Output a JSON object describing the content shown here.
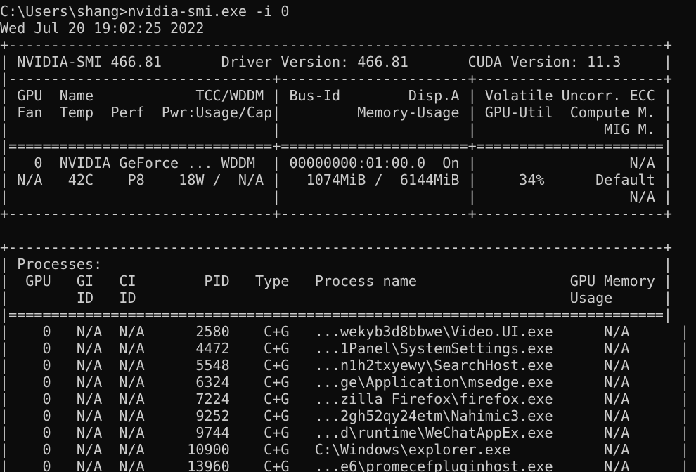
{
  "terminal": {
    "command_line": "C:\\Users\\shang>nvidia-smi.exe -i 0",
    "timestamp": "Wed Jul 20 19:02:25 2022",
    "colors": {
      "background": "#0c0c0c",
      "foreground": "#cccccc"
    }
  },
  "gpu_table": {
    "border_top": "+-----------------------------------------------------------------------------+",
    "header_info": "| NVIDIA-SMI 466.81       Driver Version: 466.81       CUDA Version: 11.3     |",
    "header_sep": "|-------------------------------+----------------------+----------------------+",
    "col_head_1": "| GPU  Name            TCC/WDDM | Bus-Id        Disp.A | Volatile Uncorr. ECC |",
    "col_head_2": "| Fan  Temp  Perf  Pwr:Usage/Cap|         Memory-Usage | GPU-Util  Compute M. |",
    "col_head_3": "|                               |                      |               MIG M. |",
    "double_sep": "|===============================+======================+======================|",
    "row_1": "|   0  NVIDIA GeForce ... WDDM  | 00000000:01:00.0  On |                  N/A |",
    "row_2": "| N/A   42C    P8    18W /  N/A |   1074MiB /  6144MiB |     34%      Default |",
    "row_3": "|                               |                      |                  N/A |",
    "border_bottom": "+-------------------------------+----------------------+----------------------+"
  },
  "processes_table": {
    "border_top": "+-----------------------------------------------------------------------------+",
    "title": "| Processes:                                                                  |",
    "head_1": "|  GPU   GI   CI        PID   Type   Process name                  GPU Memory |",
    "head_2": "|        ID   ID                                                   Usage      |",
    "double_sep": "|=============================================================================|",
    "rows": [
      "|    0   N/A  N/A      2580    C+G   ...wekyb3d8bbwe\\Video.UI.exe      N/A      |",
      "|    0   N/A  N/A      4472    C+G   ...1Panel\\SystemSettings.exe      N/A      |",
      "|    0   N/A  N/A      5548    C+G   ...n1h2txyewy\\SearchHost.exe      N/A      |",
      "|    0   N/A  N/A      6324    C+G   ...ge\\Application\\msedge.exe      N/A      |",
      "|    0   N/A  N/A      7224    C+G   ...zilla Firefox\\firefox.exe      N/A      |",
      "|    0   N/A  N/A      9252    C+G   ...2gh52qy24etm\\Nahimic3.exe      N/A      |",
      "|    0   N/A  N/A      9744    C+G   ...d\\runtime\\WeChatAppEx.exe      N/A      |",
      "|    0   N/A  N/A     10900    C+G   C:\\Windows\\explorer.exe           N/A      |",
      "|    0   N/A  N/A     13960    C+G   ...e6\\promecefpluginhost.exe      N/A      |"
    ]
  }
}
